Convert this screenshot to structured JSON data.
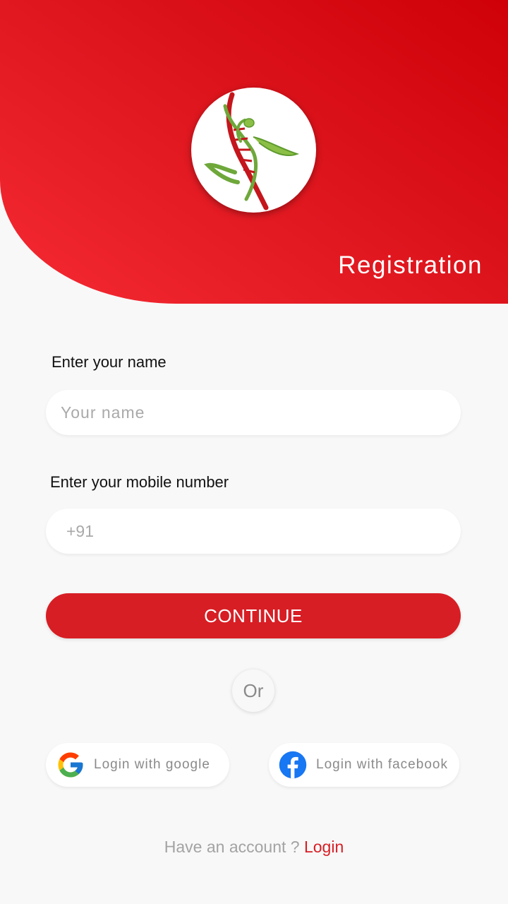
{
  "header": {
    "title": "Registration",
    "logo_icon": "dna-runner-logo-icon"
  },
  "form": {
    "name_label": "Enter your name",
    "name_placeholder": "Your name",
    "name_value": "",
    "mobile_label": "Enter your mobile number",
    "mobile_placeholder": "+91",
    "mobile_value": ""
  },
  "actions": {
    "continue_label": "CONTINUE",
    "or_label": "Or"
  },
  "social": {
    "google_label": "Login with google",
    "google_icon": "google-icon",
    "facebook_label": "Login with facebook",
    "facebook_icon": "facebook-icon"
  },
  "footer": {
    "prompt": "Have an account ?",
    "link": "Login"
  },
  "colors": {
    "brand_red": "#d71e24",
    "header_gradient_dark": "#cf0008",
    "header_gradient_light": "#f52a33",
    "background": "#f8f8f8",
    "facebook_blue": "#1877f2"
  }
}
